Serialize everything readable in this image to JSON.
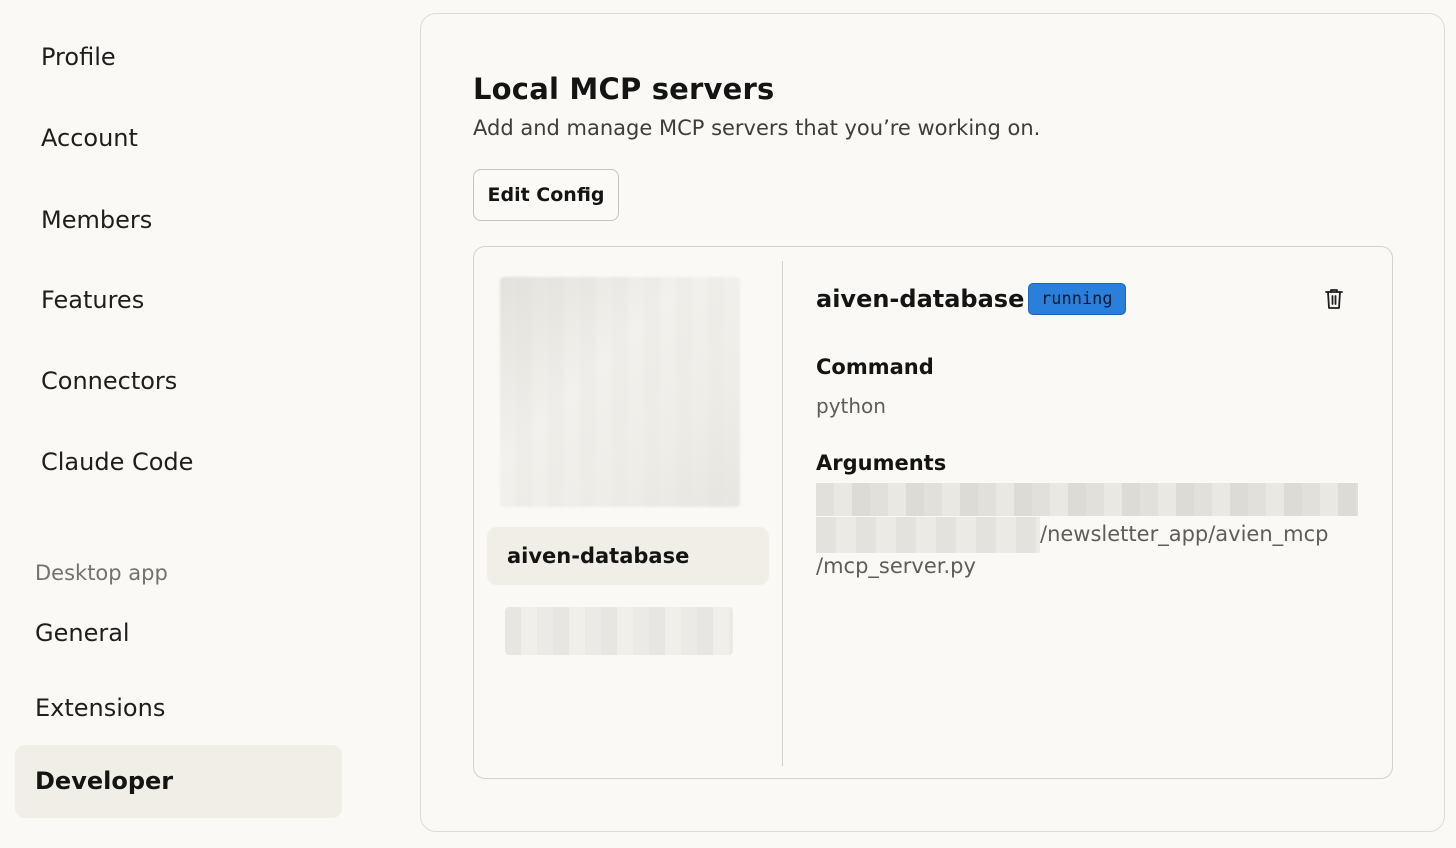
{
  "sidebar": {
    "items": [
      {
        "label": "Profile"
      },
      {
        "label": "Account"
      },
      {
        "label": "Members"
      },
      {
        "label": "Features"
      },
      {
        "label": "Connectors"
      },
      {
        "label": "Claude Code"
      }
    ],
    "desktop_section_label": "Desktop app",
    "desktop_items": [
      {
        "label": "General"
      },
      {
        "label": "Extensions"
      },
      {
        "label": "Developer",
        "active": true
      }
    ]
  },
  "panel": {
    "title": "Local MCP servers",
    "subtitle": "Add and manage MCP servers that you’re working on.",
    "edit_config_label": "Edit Config"
  },
  "servers": {
    "list": [
      {
        "name": "aiven-database",
        "selected": true
      }
    ],
    "selected": {
      "name": "aiven-database",
      "status": "running",
      "status_color": "#2b7fdc",
      "delete_icon": "trash-icon",
      "command_label": "Command",
      "command_value": "python",
      "arguments_label": "Arguments",
      "arguments_line1": "/newsletter_app/avien_mcp",
      "arguments_line2": "/mcp_server.py"
    }
  }
}
